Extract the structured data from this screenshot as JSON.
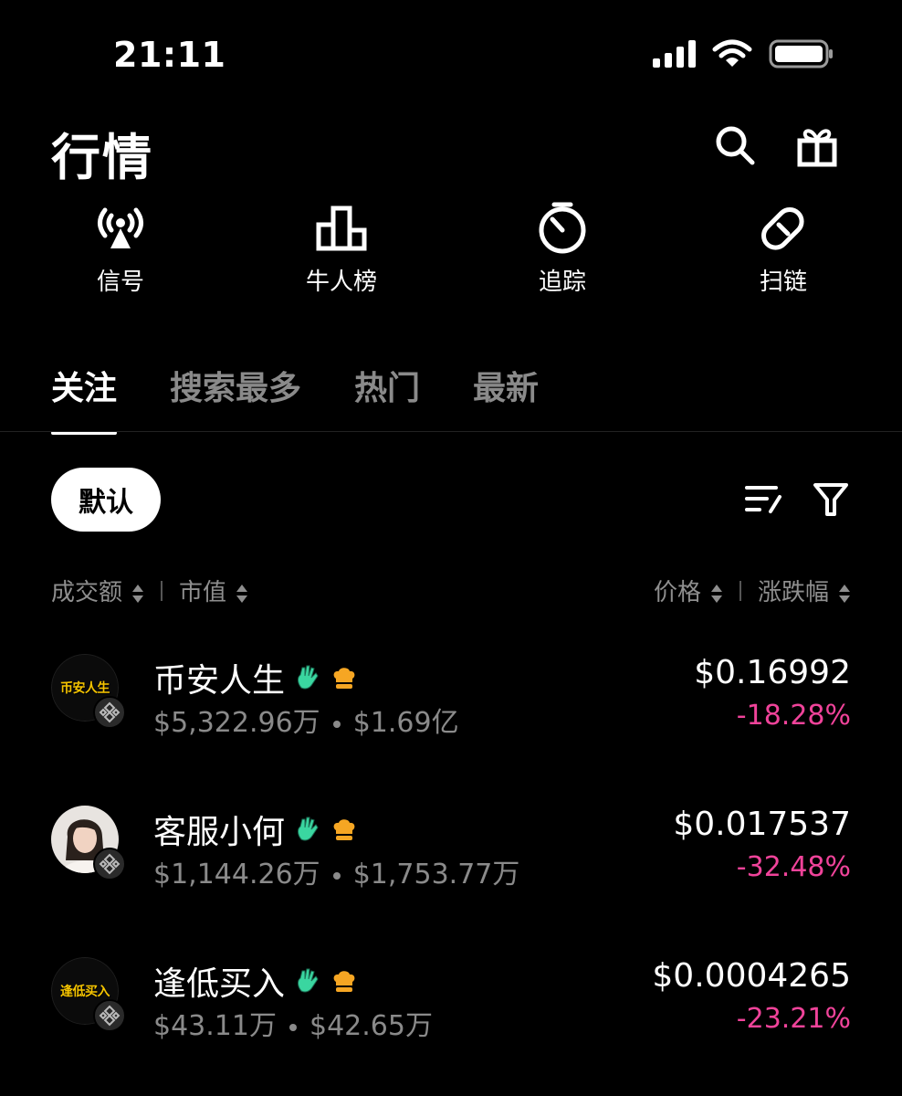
{
  "status": {
    "time": "21:11",
    "icons": [
      "signal-icon",
      "wifi-icon",
      "battery-icon"
    ]
  },
  "header": {
    "title": "行情",
    "icons": [
      "search-icon",
      "gift-icon"
    ]
  },
  "quick_actions": [
    {
      "label": "信号",
      "icon": "broadcast-icon"
    },
    {
      "label": "牛人榜",
      "icon": "leaderboard-icon"
    },
    {
      "label": "追踪",
      "icon": "tracking-icon"
    },
    {
      "label": "扫链",
      "icon": "link-icon"
    }
  ],
  "tabs": [
    {
      "label": "关注",
      "active": true
    },
    {
      "label": "搜索最多",
      "active": false
    },
    {
      "label": "热门",
      "active": false
    },
    {
      "label": "最新",
      "active": false
    }
  ],
  "filter": {
    "default_label": "默认",
    "icons": [
      "sort-list-icon",
      "filter-icon"
    ]
  },
  "columns": {
    "volume": "成交额",
    "market_cap": "市值",
    "price": "价格",
    "change": "涨跌幅"
  },
  "tokens": [
    {
      "name": "币安人生",
      "avatar_text": "币安人生",
      "volume": "$5,322.96万",
      "market_cap": "$1.69亿",
      "price": "$0.16992",
      "change": "-18.28%"
    },
    {
      "name": "客服小何",
      "avatar_text": "",
      "volume": "$1,144.26万",
      "market_cap": "$1,753.77万",
      "price": "$0.017537",
      "change": "-32.48%"
    },
    {
      "name": "逢低买入",
      "avatar_text": "逢低买入",
      "volume": "$43.11万",
      "market_cap": "$42.65万",
      "price": "$0.0004265",
      "change": "-23.21%"
    }
  ],
  "colors": {
    "background": "#000000",
    "negative_change": "#f0439a",
    "muted_text": "#8a8a8a",
    "badge_green": "#3ad6a0",
    "badge_gold": "#f6a623"
  }
}
